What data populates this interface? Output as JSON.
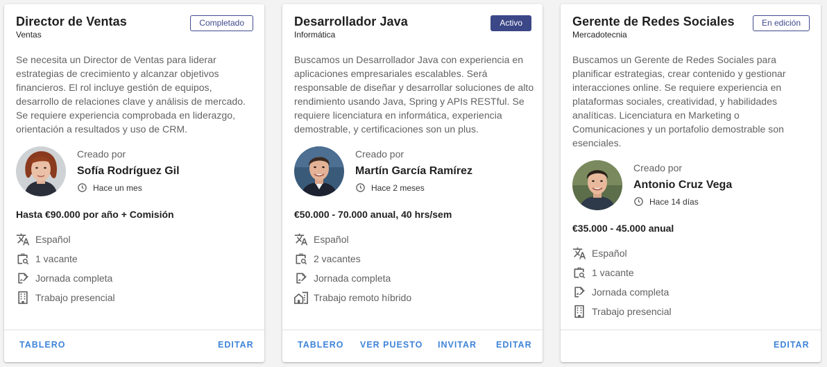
{
  "cards": [
    {
      "title": "Director de Ventas",
      "department": "Ventas",
      "status": "Completado",
      "description": "Se necesita un Director de Ventas para liderar estrategias de crecimiento y alcanzar objetivos financieros. El rol incluye gestión de equipos, desarrollo de relaciones clave y análisis de mercado. Se requiere experiencia comprobada en liderazgo, orientación a resultados y uso de CRM.",
      "created_by_label": "Creado por",
      "creator": "Sofía Rodríguez Gil",
      "created_ago": "Hace un mes",
      "salary": "Hasta €90.000 por año + Comisión",
      "language": "Español",
      "vacancies": "1 vacante",
      "schedule": "Jornada completa",
      "work_mode": "Trabajo presencial",
      "actions": {
        "dashboard": "TABLERO",
        "edit": "EDITAR"
      }
    },
    {
      "title": "Desarrollador Java",
      "department": "Informática",
      "status": "Activo",
      "description": "Buscamos un Desarrollador Java con experiencia en aplicaciones empresariales escalables. Será responsable de diseñar y desarrollar soluciones de alto rendimiento usando Java, Spring y APIs RESTful. Se requiere licenciatura en informática, experiencia demostrable, y certificaciones son un plus.",
      "created_by_label": "Creado por",
      "creator": "Martín García Ramírez",
      "created_ago": "Hace 2 meses",
      "salary": "€50.000 - 70.000 anual, 40 hrs/sem",
      "language": "Español",
      "vacancies": "2 vacantes",
      "schedule": "Jornada completa",
      "work_mode": "Trabajo remoto híbrido",
      "actions": {
        "dashboard": "TABLERO",
        "view": "VER PUESTO",
        "invite": "INVITAR",
        "edit": "EDITAR"
      }
    },
    {
      "title": "Gerente de Redes Sociales",
      "department": "Mercadotecnia",
      "status": "En edición",
      "description": "Buscamos un Gerente de Redes Sociales para planificar estrategias, crear contenido y gestionar interacciones online. Se requiere experiencia en plataformas sociales, creatividad, y habilidades analíticas. Licenciatura en Marketing o Comunicaciones y un portafolio demostrable son esenciales.",
      "created_by_label": "Creado por",
      "creator": "Antonio Cruz Vega",
      "created_ago": "Hace 14 días",
      "salary": "€35.000 - 45.000 anual",
      "language": "Español",
      "vacancies": "1 vacante",
      "schedule": "Jornada completa",
      "work_mode": "Trabajo presencial",
      "actions": {
        "edit": "EDITAR"
      }
    }
  ],
  "colors": {
    "accent": "#3f84d8",
    "badge": "#3c4788",
    "muted_text": "#616161"
  },
  "icons": {
    "language": "translate-icon",
    "vacancies": "briefcase-search-icon",
    "schedule": "contract-signature-icon",
    "work_mode_office": "office-building-icon",
    "work_mode_hybrid": "home-city-icon",
    "time": "clock-icon"
  }
}
